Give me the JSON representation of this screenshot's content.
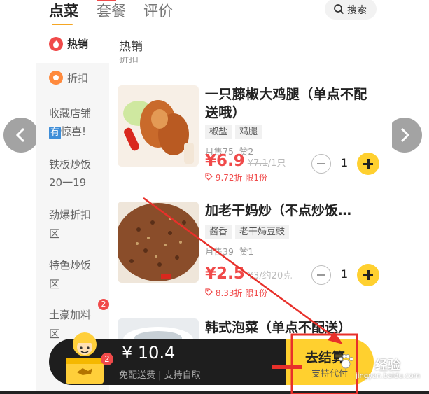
{
  "tabs": [
    {
      "label": "点菜"
    },
    {
      "label": "套餐"
    },
    {
      "label": "评价"
    }
  ],
  "search": {
    "label": "搜索"
  },
  "sidebar": {
    "items": [
      {
        "label": "热销"
      },
      {
        "label": "折扣"
      },
      {
        "label_line1": "收藏店铺",
        "you": "有",
        "label_line2": "惊喜!"
      },
      {
        "label_line1": "铁板炒饭",
        "label_line2": "20一19"
      },
      {
        "label_line1": "劲爆折扣",
        "label_line2": "区"
      },
      {
        "label_line1": "特色炒饭",
        "label_line2": "区"
      },
      {
        "label_line1": "土豪加料",
        "label_line2": "区",
        "badge": "2"
      }
    ]
  },
  "section": {
    "title": "热销",
    "ghost": "折扣"
  },
  "dishes": [
    {
      "name": "一只藤椒大鸡腿（单点不配送哦）",
      "tags": [
        "椒盐",
        "鸡腿"
      ],
      "monthly": "月售75",
      "likes": "赞2",
      "price": "¥6.9",
      "orig": "¥7.1",
      "unit": "/1只",
      "discount": "9.72折 限1份",
      "qty": "1"
    },
    {
      "name": "加老干妈炒（不点炒饭…",
      "tags": [
        "酱香",
        "老干妈豆豉"
      ],
      "monthly": "月售39",
      "likes": "赞1",
      "price": "¥2.5",
      "orig": "¥3",
      "unit": "/约20克",
      "discount": "8.33折 限1份",
      "qty": "1"
    },
    {
      "name": "韩式泡菜（单点不配送）"
    }
  ],
  "cart": {
    "badge": "2",
    "total": "¥ 10.4",
    "sub": "免配送费 | 支持自取",
    "checkout": "去结算",
    "checkout_sub": "支持代付"
  },
  "watermark": {
    "text": "经验",
    "sub": "jingyan.baidu.com"
  },
  "colors": {
    "accent": "#ffd02f",
    "price": "#f04a4a",
    "annotation": "#e8302a"
  }
}
